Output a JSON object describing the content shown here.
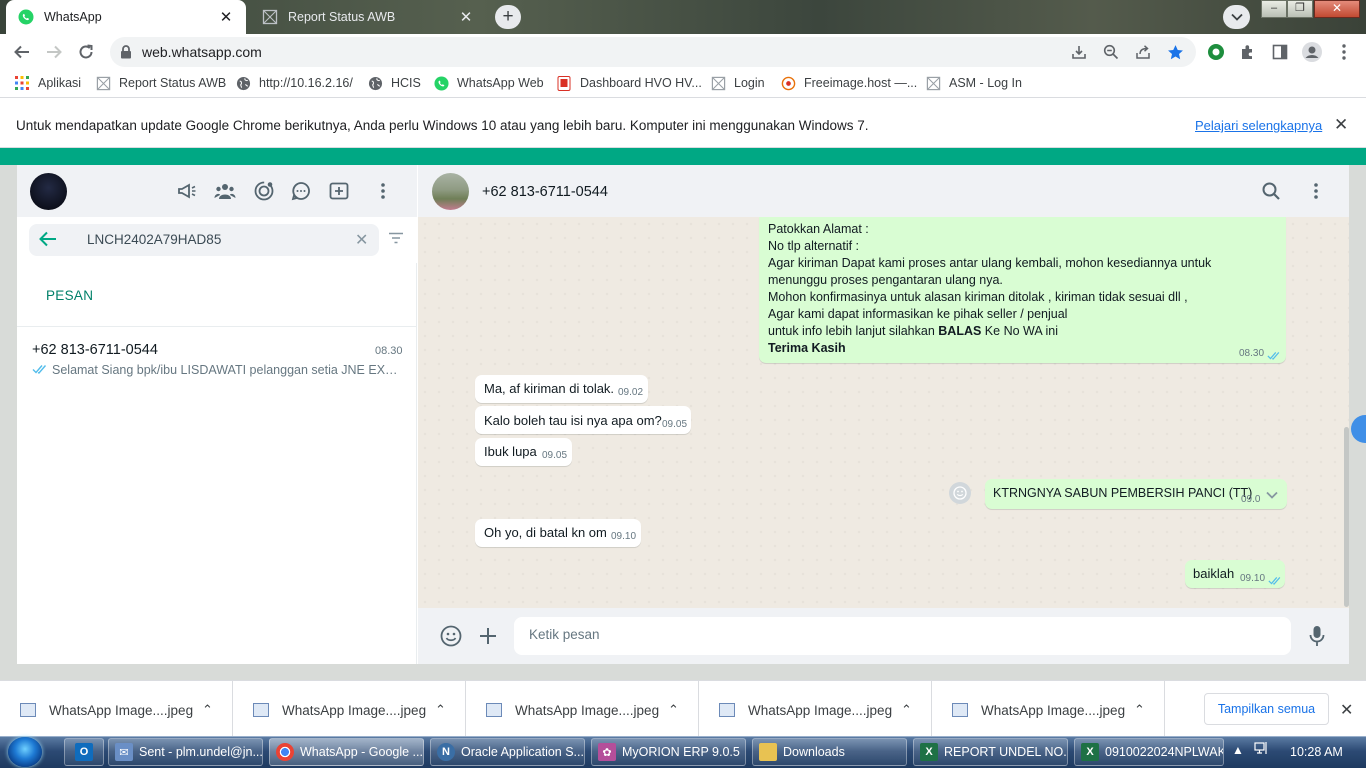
{
  "browser": {
    "tabs": [
      {
        "label": "WhatsApp",
        "active": true
      },
      {
        "label": "Report Status AWB",
        "active": false
      }
    ],
    "url": "web.whatsapp.com",
    "bookmarks": [
      {
        "label": "Aplikasi",
        "icon": "apps-grid-icon"
      },
      {
        "label": "Report Status AWB",
        "icon": "page-icon"
      },
      {
        "label": "http://10.16.2.16/",
        "icon": "globe-icon"
      },
      {
        "label": "HCIS",
        "icon": "globe-icon"
      },
      {
        "label": "WhatsApp Web",
        "icon": "whatsapp-icon"
      },
      {
        "label": "Dashboard HVO HV...",
        "icon": "dashboard-icon"
      },
      {
        "label": "Login",
        "icon": "page-icon"
      },
      {
        "label": "Freeimage.host —...",
        "icon": "freeimage-icon"
      },
      {
        "label": "ASM - Log In",
        "icon": "page-icon"
      }
    ],
    "infobar": {
      "message": "Untuk mendapatkan update Google Chrome berikutnya, Anda perlu Windows 10 atau yang lebih baru. Komputer ini menggunakan Windows 7.",
      "link": "Pelajari selengkapnya"
    }
  },
  "whatsapp": {
    "search_query": "LNCH2402A79HAD85",
    "section_label": "PESAN",
    "result": {
      "name": "+62 813-6711-0544",
      "time": "08.30",
      "snippet": "Selamat Siang   bpk/ibu LISDAWATI pelanggan setia JNE EXP..."
    },
    "contact": "+62 813-6711-0544",
    "long_message": {
      "lines": [
        "Patokkan Alamat :",
        "No tlp alternatif :",
        "Agar kiriman Dapat kami proses antar ulang kembali, mohon kesediannya untuk",
        "menunggu proses pengantaran ulang nya.",
        "Mohon konfirmasinya untuk alasan kiriman ditolak , kiriman tidak sesuai dll ,",
        "Agar kami dapat informasikan ke pihak seller / penjual"
      ],
      "balas_prefix": "untuk info lebih lanjut silahkan ",
      "balas_word": "BALAS",
      "balas_suffix": " Ke No WA ini",
      "closing": "Terima Kasih",
      "time": "08.30"
    },
    "messages": [
      {
        "text": "Ma, af kiriman di tolak.",
        "time": "09.02",
        "dir": "in"
      },
      {
        "text": "Kalo boleh tau isi nya apa om?",
        "time": "09.05",
        "dir": "in"
      },
      {
        "text": "Ibuk lupa",
        "time": "09.05",
        "dir": "in"
      },
      {
        "text": "KTRNGNYA SABUN PEMBERSIH PANCI (TT)",
        "time": "09.0",
        "dir": "out"
      },
      {
        "text": "Oh yo, di batal kn om",
        "time": "09.10",
        "dir": "in"
      },
      {
        "text": "baiklah",
        "time": "09.10",
        "dir": "out"
      }
    ],
    "composer_placeholder": "Ketik pesan",
    "colors": {
      "accent": "#00a884",
      "outgoing": "#d9fdd3",
      "chat_bg": "#efeae2",
      "tick": "#53bdeb"
    }
  },
  "downloads": {
    "items": [
      "WhatsApp Image....jpeg",
      "WhatsApp Image....jpeg",
      "WhatsApp Image....jpeg",
      "WhatsApp Image....jpeg",
      "WhatsApp Image....jpeg"
    ],
    "show_all": "Tampilkan semua"
  },
  "taskbar": {
    "items": [
      {
        "label": "Sent - plm.undel@jn...",
        "icon": "outlook-icon"
      },
      {
        "label": "WhatsApp - Google ...",
        "icon": "chrome-icon"
      },
      {
        "label": "Oracle Application S...",
        "icon": "oracle-icon"
      },
      {
        "label": "MyORION ERP 9.0.5",
        "icon": "orion-icon"
      },
      {
        "label": "Downloads",
        "icon": "folder-icon"
      },
      {
        "label": "REPORT UNDEL NO...",
        "icon": "excel-icon"
      },
      {
        "label": "0910022024NPLWAK...",
        "icon": "excel-icon"
      }
    ],
    "clock": "10:28 AM"
  }
}
